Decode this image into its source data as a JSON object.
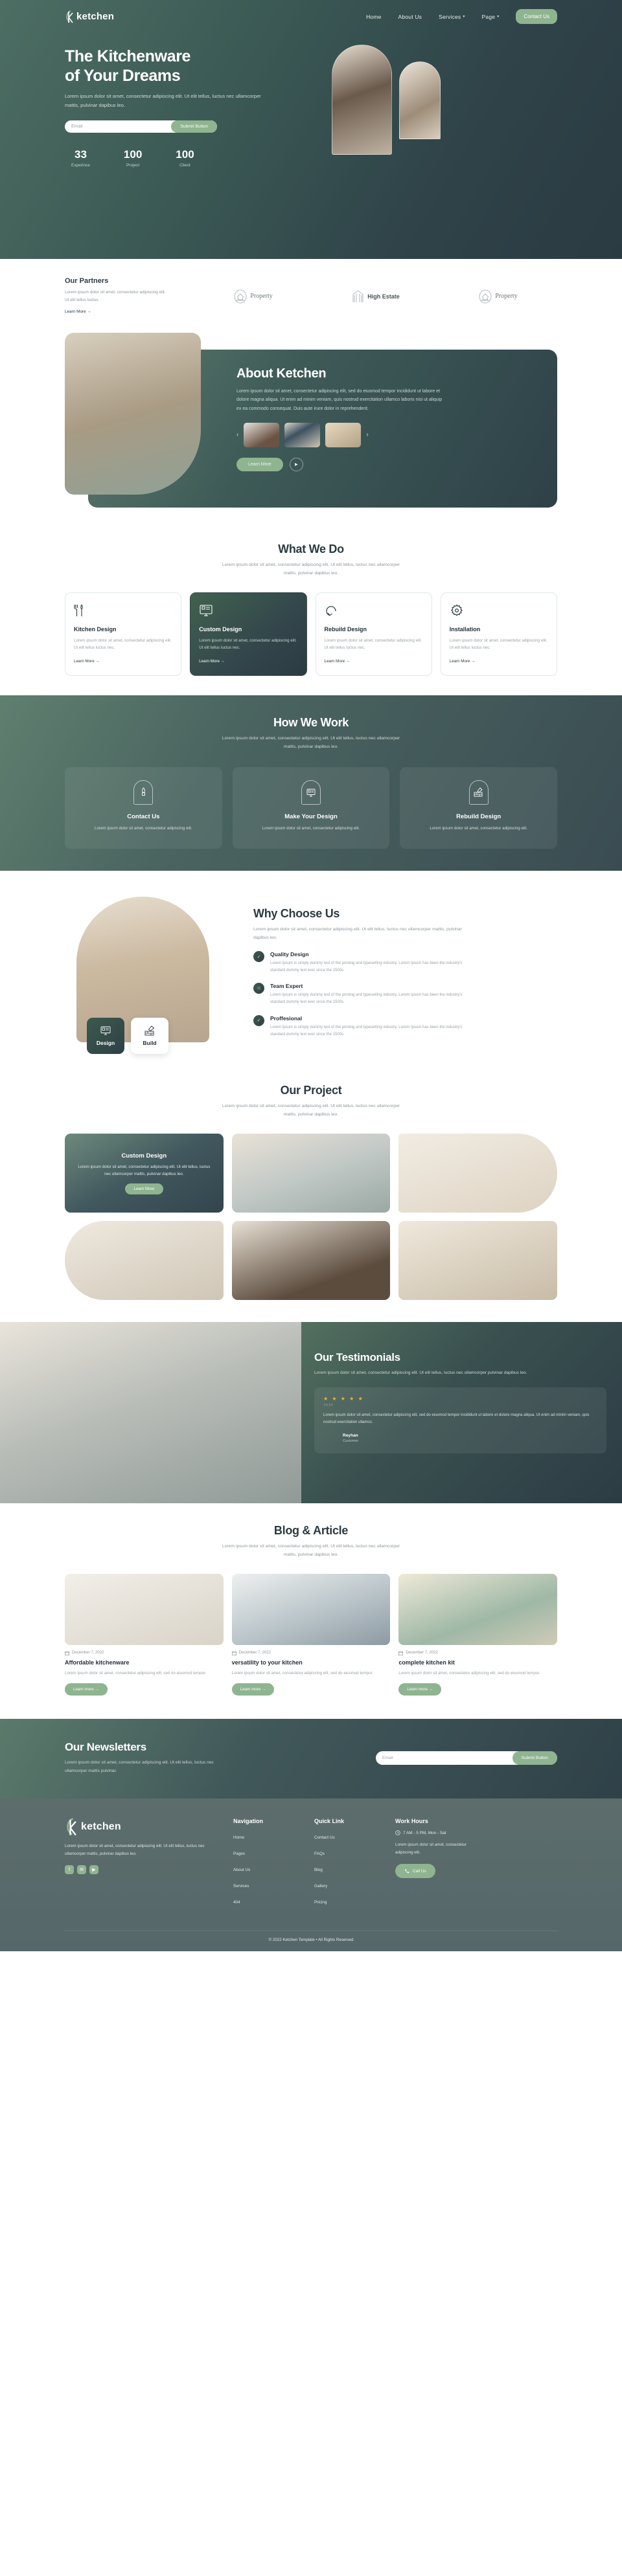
{
  "brand": {
    "name": "ketchen",
    "logo_letter": "k"
  },
  "nav": {
    "links": [
      {
        "label": "Home",
        "caret": ""
      },
      {
        "label": "About Us",
        "caret": ""
      },
      {
        "label": "Services",
        "caret": "▾"
      },
      {
        "label": "Page",
        "caret": "▾"
      }
    ],
    "cta": "Contact Us"
  },
  "hero": {
    "title_line1": "The Kitchenware",
    "title_line2": "of Your Dreams",
    "paragraph": "Lorem ipsum dolor sit amet, consectetur adipiscing elit. Ut elit tellus, luctus nec ullamcorper mattis, pulvinar dapibus leo.",
    "email_placeholder": "Email",
    "email_value": "",
    "submit_label": "Submit Button",
    "stats": [
      {
        "number": "33",
        "label": "Experince"
      },
      {
        "number": "100",
        "label": "Project"
      },
      {
        "number": "100",
        "label": "Client"
      }
    ]
  },
  "partners": {
    "title": "Our Partners",
    "paragraph": "Lorem ipsum dolor sit amet, consectetur adipiscing elit. Ut elit tellus luctus.",
    "learn_more": "Learn More →",
    "logos": [
      {
        "name": "Property",
        "style": "serif"
      },
      {
        "name": "High Estate",
        "style": "sans"
      },
      {
        "name": "Property",
        "style": "serif"
      }
    ]
  },
  "about": {
    "title": "About Ketchen",
    "paragraph": "Lorem ipsum dolor sit amet, consectetur adipiscing elit, sed do eiusmod tempor incididunt ut labore et dolore magna aliqua. Ut enim ad minim veniam, quis nostrud exercitation ullamco laboris nisi ut aliquip ex ea commodo consequat. Duis aute irure dolor in reprehenderit.",
    "prev": "‹",
    "next": "›",
    "learn_more": "Learn More",
    "play": "▶"
  },
  "what_we_do": {
    "title": "What We Do",
    "subtitle": "Lorem ipsum dolor sit amet, consectetur adipiscing elit. Ut elit tellus, luctus nec ullamcorper mattis, pulvinar dapibus leo.",
    "cards": [
      {
        "icon": "fork-knife-icon",
        "title": "Kitchen Design",
        "text": "Lorem ipsum dolor sit amet, consectetur adipiscing elit. Ut elit tellus luctus nec.",
        "link": "Learn More →",
        "highlighted": false
      },
      {
        "icon": "monitor-design-icon",
        "title": "Custom Design",
        "text": "Lorem ipsum dolor sit amet, consectetur adipiscing elit. Ut elit tellus luctus nec.",
        "link": "Learn More →",
        "highlighted": true
      },
      {
        "icon": "refresh-arrow-icon",
        "title": "Rebuild Design",
        "text": "Lorem ipsum dolor sit amet, consectetur adipiscing elit. Ut elit tellus luctus nec.",
        "link": "Learn More →",
        "highlighted": false
      },
      {
        "icon": "gear-icon",
        "title": "Installation",
        "text": "Lorem ipsum dolor sit amet, consectetur adipiscing elit. Ut elit tellus luctus nec.",
        "link": "Learn More →",
        "highlighted": false
      }
    ]
  },
  "how_we_work": {
    "title": "How We Work",
    "subtitle": "Lorem ipsum dolor sit amet, consectetur adipiscing elit. Ut elit tellus, luctus nec ullamcorper mattis, pulvinar dapibus leo.",
    "steps": [
      {
        "icon": "hand-tool-icon",
        "title": "Contact Us",
        "text": "Lorem ipsum dolor sit amet, consectetur adipiscing elit."
      },
      {
        "icon": "monitor-design-icon",
        "title": "Make Your Design",
        "text": "Lorem ipsum dolor sit amet, consectetur adipiscing elit."
      },
      {
        "icon": "trowel-brick-icon",
        "title": "Rebuild Design",
        "text": "Lorem ipsum dolor sit amet, consectetur adipiscing elit."
      }
    ]
  },
  "why_choose_us": {
    "title": "Why Choose Us",
    "lead": "Lorem ipsum dolor sit amet, consectetur adipiscing elit. Ut elit tellus, luctus nec ullamcorper mattis, pulvinar dapibus leo.",
    "tabs": [
      {
        "label": "Design",
        "icon": "monitor-design-icon",
        "active": true
      },
      {
        "label": "Build",
        "icon": "trowel-brick-icon",
        "active": false
      }
    ],
    "features": [
      {
        "title": "Quality Design",
        "text": "Lorem Ipsum is simply dummy text of the printing and typesetting industry. Lorem Ipsum has been the industry's standard dummy text ever since the 1500s."
      },
      {
        "title": "Team Expert",
        "text": "Lorem Ipsum is simply dummy text of the printing and typesetting industry. Lorem Ipsum has been the industry's standard dummy text ever since the 1500s."
      },
      {
        "title": "Proffesional",
        "text": "Lorem Ipsum is simply dummy text of the printing and typesetting industry. Lorem Ipsum has been the industry's standard dummy text ever since the 1500s."
      }
    ]
  },
  "our_project": {
    "title": "Our Project",
    "subtitle": "Lorem ipsum dolor sit amet, consectetur adipiscing elit. Ut elit tellus, luctus nec ullamcorper mattis, pulvinar dapibus leo.",
    "featured": {
      "title": "Custom Design",
      "text": "Lorem ipsum dolor sit amet, consectetur adipiscing elit. Ut elit tellus, luctus nec ullamcorper mattis, pulvinar dapibus leo.",
      "button": "Learn More"
    }
  },
  "testimonials": {
    "title": "Our Testimonials",
    "subtitle": "Lorem ipsum dolor sit amet, consectetur adipiscing elit. Ut elit tellus, luctus nec ullamcorper pulvinar dapibus leo.",
    "stars": "★ ★ ★ ★ ★",
    "quote_mark": "””",
    "quote": "Lorem ipsum dolor sit amet, consectetur adipiscing elit, sed do eiusmod tempor incididunt ut labore et dolore magna aliqua. Ut enim ad minim veniam, quis nostrud exercitation ullamco.",
    "author": "Reyhan",
    "role": "Customer"
  },
  "blog": {
    "title": "Blog & Article",
    "subtitle": "Lorem ipsum dolor sit amet, consectetur adipiscing elit. Ut elit tellus, luctus nec ullamcorper mattis, pulvinar dapibus leo.",
    "posts": [
      {
        "date": "December 7, 2022",
        "title": "Affordable kitchenware",
        "text": "Lorem ipsum dolor sit amet, consectetur adipiscing elit, sed do eiusmod tempor.",
        "button": "Learn more →"
      },
      {
        "date": "December 7, 2022",
        "title": "versatility to your kitchen",
        "text": "Lorem ipsum dolor sit amet, consectetur adipiscing elit, sed do eiusmod tempor.",
        "button": "Learn more →"
      },
      {
        "date": "December 7, 2022",
        "title": "complete kitchen kit",
        "text": "Lorem ipsum dolor sit amet, consectetur adipiscing elit, sed do eiusmod tempor.",
        "button": "Learn more →"
      }
    ]
  },
  "newsletter": {
    "title": "Our Newsletters",
    "paragraph": "Lorem ipsum dolor sit amet, consectetur adipiscing elit. Ut elit tellus, luctus nec ullamcorper mattis pulvinar.",
    "email_placeholder": "Email",
    "email_value": "",
    "submit_label": "Submit Button"
  },
  "footer": {
    "brand_text": "Lorem ipsum dolor sit amet, consectetur adipiscing elit. Ut elit tellus, luctus nec ullamcorper mattis, pulvinar dapibus leo.",
    "socials": [
      {
        "name": "facebook-icon",
        "glyph": "f"
      },
      {
        "name": "twitter-icon",
        "glyph": "✉"
      },
      {
        "name": "youtube-icon",
        "glyph": "▶"
      }
    ],
    "navigation": {
      "heading": "Navigation",
      "items": [
        "Home",
        "Pages",
        "About Us",
        "Services",
        "404"
      ]
    },
    "quick_link": {
      "heading": "Quick Link",
      "items": [
        "Contact Us",
        "FAQs",
        "Blog",
        "Gallery",
        "Pricing"
      ]
    },
    "work_hours": {
      "heading": "Work Hours",
      "hours": "7 AM - 5 PM, Mon - Sat",
      "text": "Lorem ipsum dolor sit amet, consectetur adipiscing elit.",
      "call_button": "Call Us"
    },
    "copyright": "© 2022 Ketchen Template • All Rights Reserved"
  },
  "colors": {
    "accent": "#8fb490",
    "dark": "#2c3b42",
    "green": "#4d6e63",
    "star": "#f0b429"
  }
}
